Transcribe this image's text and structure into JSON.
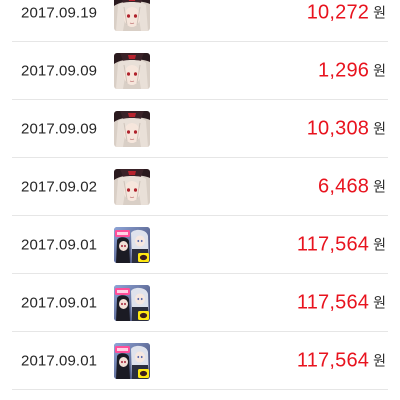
{
  "colors": {
    "amount": "#e8131e",
    "divider": "#e6e6e6",
    "date_text": "#262626"
  },
  "transactions": [
    {
      "date": "2017.09.19",
      "icon": "game-a-character-icon",
      "amount": "10,272",
      "unit": "원"
    },
    {
      "date": "2017.09.09",
      "icon": "game-a-character-icon",
      "amount": "1,296",
      "unit": "원"
    },
    {
      "date": "2017.09.09",
      "icon": "game-a-character-icon",
      "amount": "10,308",
      "unit": "원"
    },
    {
      "date": "2017.09.02",
      "icon": "game-a-character-icon",
      "amount": "6,468",
      "unit": "원"
    },
    {
      "date": "2017.09.01",
      "icon": "game-b-kakao-icon",
      "amount": "117,564",
      "unit": "원"
    },
    {
      "date": "2017.09.01",
      "icon": "game-b-kakao-icon",
      "amount": "117,564",
      "unit": "원"
    },
    {
      "date": "2017.09.01",
      "icon": "game-b-kakao-icon",
      "amount": "117,564",
      "unit": "원"
    }
  ]
}
